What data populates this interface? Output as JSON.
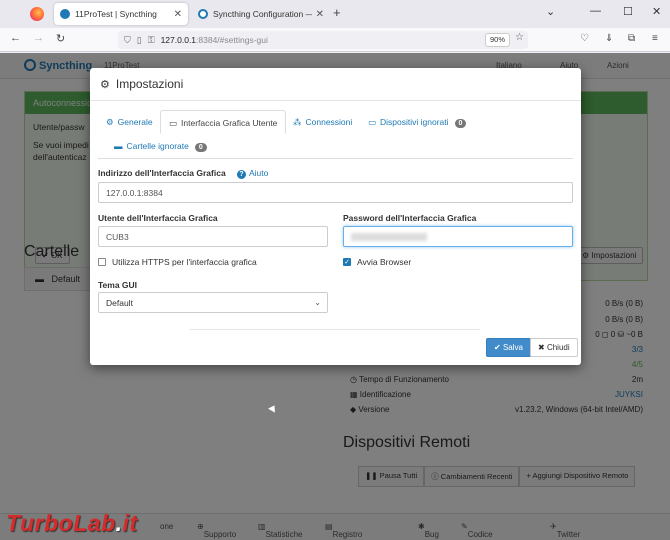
{
  "browser": {
    "tabs": [
      {
        "title": "11ProTest | Syncthing",
        "active": true
      },
      {
        "title": "Syncthing Configuration — Syn",
        "active": false
      }
    ],
    "url_host": "127.0.0.1",
    "url_path": ":8384/#settings-gui",
    "zoom": "90%"
  },
  "page": {
    "brand": "Syncthing",
    "hostname": "11ProTest",
    "topnav": [
      "Italiano",
      "Aiuto",
      "Azioni"
    ],
    "alert_title": "Autoconnessione",
    "alert_lines": [
      "Utente/passw",
      "Se vuoi impedi",
      "dell'autenticaz"
    ],
    "alert_ok": "OK",
    "alert_settings": "Impostazioni",
    "folders_title": "Cartelle",
    "folder_default": "Default",
    "stats": {
      "rate1": "0 B/s (0 B)",
      "rate2": "0 B/s (0 B)",
      "files": "0  ◻ 0  ⛁ ~0 B",
      "s1": "3/3",
      "s2": "4/5",
      "uptime_label": "Tempo di Funzionamento",
      "uptime_value": "2m",
      "id_label": "Identificazione",
      "id_value": "JUYKSI",
      "version_label": "Versione",
      "version_value": "v1.23.2, Windows (64-bit Intel/AMD)"
    },
    "remote_title": "Dispositivi Remoti",
    "remote_buttons": [
      "Pausa Tutti",
      "Cambiamenti Recenti",
      "Aggiungi Dispositivo Remoto"
    ],
    "footer": [
      "Supporto",
      "Statistiche",
      "Registro modifiche",
      "Bug",
      "Codice Sorgente",
      "Twitter"
    ],
    "footer_first": "one"
  },
  "modal": {
    "title": "Impostazioni",
    "tabs": [
      "Generale",
      "Interfaccia Grafica Utente",
      "Connessioni",
      "Dispositivi ignorati",
      "Cartelle ignorate"
    ],
    "badge_devices": "0",
    "badge_folders": "0",
    "address_label": "Indirizzo dell'Interfaccia Grafica",
    "help": "Aiuto",
    "address_value": "127.0.0.1:8384",
    "user_label": "Utente dell'Interfaccia Grafica",
    "user_value": "CUB3",
    "password_label": "Password dell'Interfaccia Grafica",
    "https_label": "Utilizza HTTPS per l'interfaccia grafica",
    "browser_label": "Avvia Browser",
    "theme_label": "Tema GUI",
    "theme_value": "Default",
    "save": "Salva",
    "close": "Chiudi"
  },
  "watermark": {
    "a": "TurboLab",
    "b": ".",
    "c": "it"
  }
}
